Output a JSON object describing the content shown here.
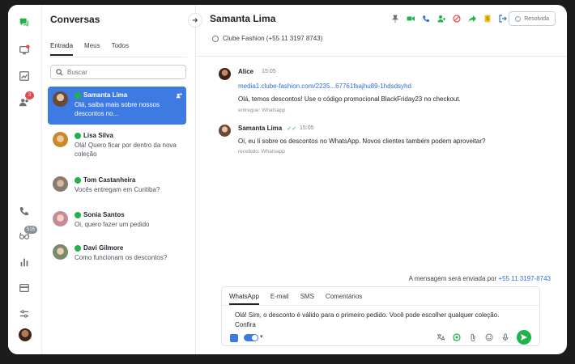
{
  "colors": {
    "accent": "#3d7be3",
    "whatsapp": "#22b14c",
    "badge": "#e5484d",
    "link": "#2f6fd8"
  },
  "rail": {
    "items": [
      {
        "icon": "chat-icon"
      },
      {
        "icon": "monitor-alert-icon"
      },
      {
        "icon": "chart-icon"
      },
      {
        "icon": "users-icon",
        "badge": "3"
      },
      {
        "icon": "phone-icon"
      },
      {
        "icon": "glasses-icon",
        "badge": "515"
      },
      {
        "icon": "bar-chart-icon"
      },
      {
        "icon": "card-icon"
      },
      {
        "icon": "sliders-icon"
      }
    ]
  },
  "conversations": {
    "title": "Conversas",
    "tabs": [
      "Entrada",
      "Meus",
      "Todos"
    ],
    "active_tab": "Entrada",
    "search_placeholder": "Buscar",
    "items": [
      {
        "name": "Samanta Lima",
        "preview": "Olá, saiba mais sobre nossos descontos no...",
        "active": true
      },
      {
        "name": "Lisa Silva",
        "preview": "Olá! Quero ficar por dentro da nova coleção",
        "active": false
      },
      {
        "name": "Tom Castanheira",
        "preview": "Vocês entregam em Curitiba?",
        "active": false
      },
      {
        "name": "Sonia Santos",
        "preview": "Oi, quero fazer um pedido",
        "active": false
      },
      {
        "name": "Davi Gilmore",
        "preview": "Como funcionam os descontos?",
        "active": false
      }
    ]
  },
  "chat": {
    "contact_name": "Samanta Lima",
    "contact_sub": "Clube Fashion (+55 11 3197 8743)",
    "resolve_label": "Resolvida",
    "messages": [
      {
        "author": "Alice",
        "time": "15:05",
        "link": "media1.clube-fashion.com/2235...67761fsajhu89-1hdsdsyhd",
        "text": "Olá, temos descontos! Use o código promocional BlackFriday23 no checkout.",
        "meta": "entregue: Whatsapp"
      },
      {
        "author": "Samanta Lima",
        "time": "15:05",
        "text": "Oi, eu li sobre os descontos no WhatsApp. Novos clientes também podem aproveitar?",
        "meta": "recebido: Whatsapp"
      }
    ],
    "send_info_prefix": "A mensagem será enviada por",
    "send_info_number": "+55 11 3197-8743",
    "composer": {
      "tabs": [
        "WhatsApp",
        "E-mail",
        "SMS",
        "Comentários"
      ],
      "active_tab": "WhatsApp",
      "line1": "Olá! Sim, o desconto é válido para o primeiro pedido. Você pode escolher qualquer coleção.",
      "line2": "Confira"
    }
  }
}
